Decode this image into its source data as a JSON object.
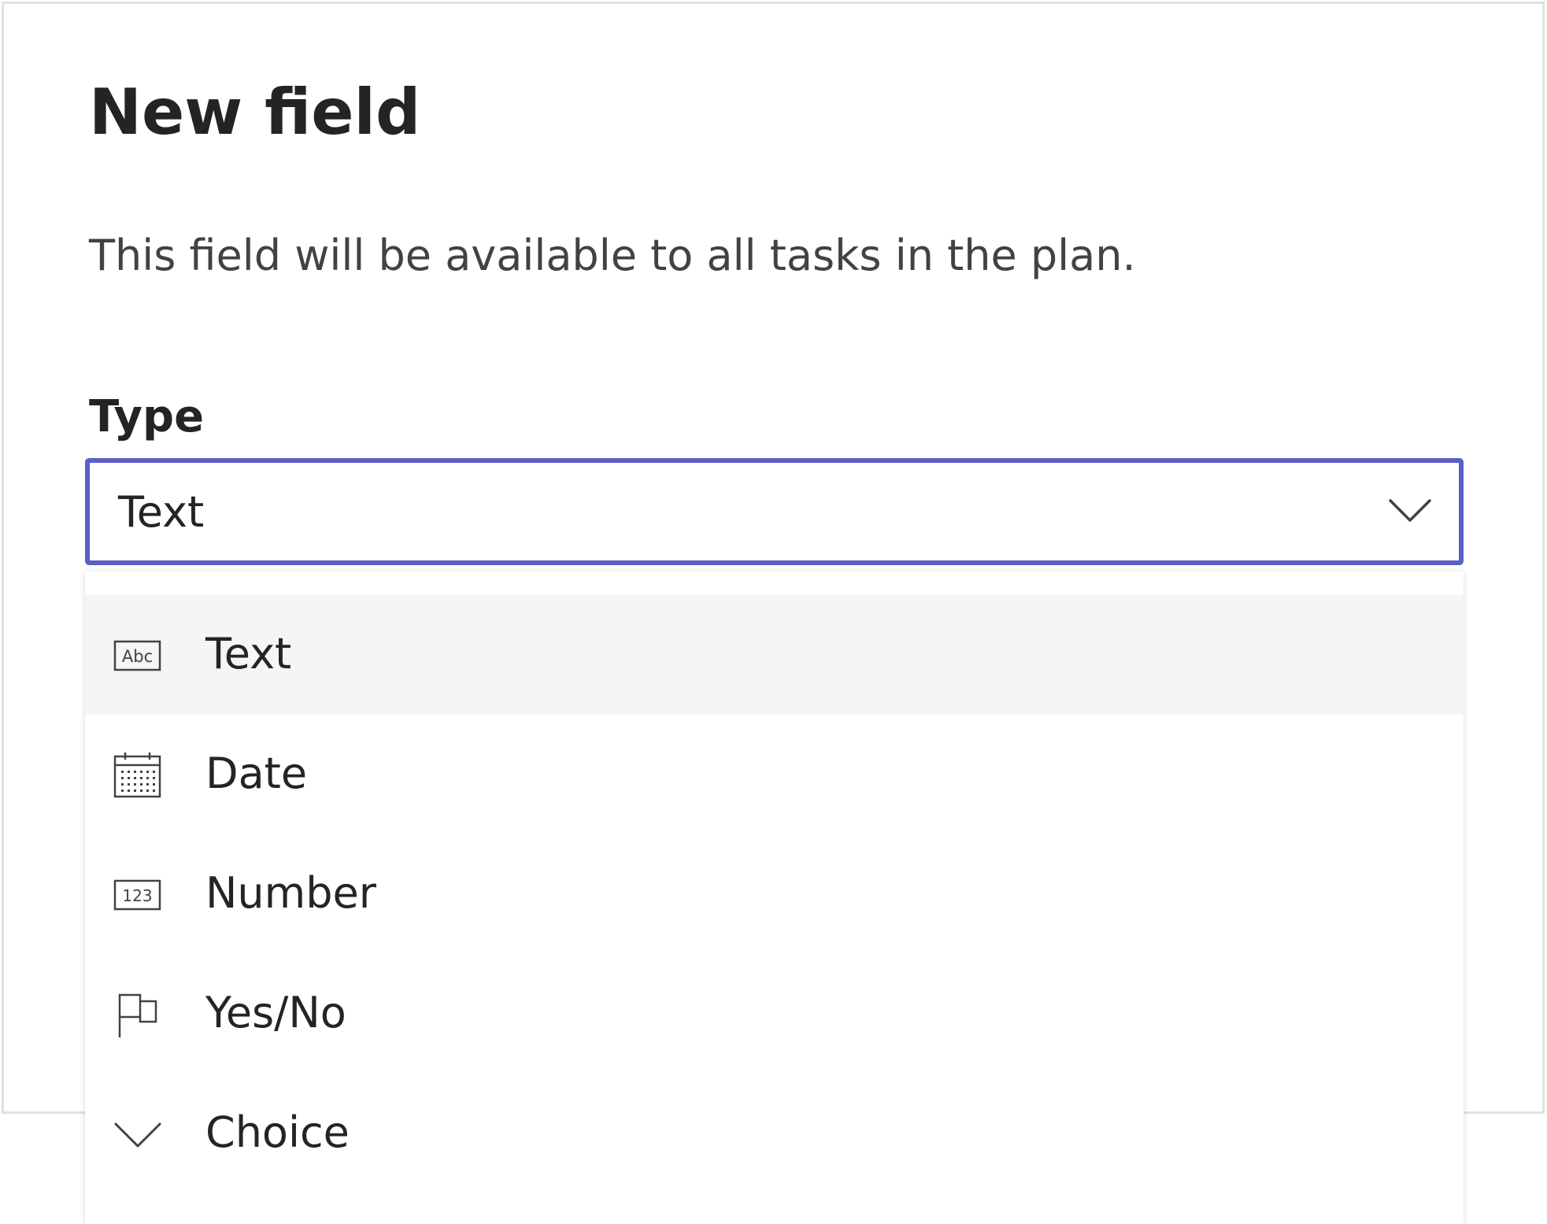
{
  "dialog": {
    "title": "New field",
    "description": "This field will be available to all tasks in the plan.",
    "type_label": "Type",
    "type_select": {
      "value": "Text",
      "icon": "chevron-down-icon"
    }
  },
  "menu": {
    "items": [
      {
        "label": "Text",
        "icon": "text-abc-icon",
        "icon_text": "Abc",
        "hovered": true
      },
      {
        "label": "Date",
        "icon": "calendar-icon"
      },
      {
        "label": "Number",
        "icon": "number-icon",
        "icon_text": "123"
      },
      {
        "label": "Yes/No",
        "icon": "flag-icon"
      },
      {
        "label": "Choice",
        "icon": "chevron-down-icon"
      }
    ]
  },
  "colors": {
    "accent": "#5b5fc7",
    "text": "#242424",
    "hover_background": "#f5f5f5",
    "dialog_border": "#e3e1de"
  }
}
